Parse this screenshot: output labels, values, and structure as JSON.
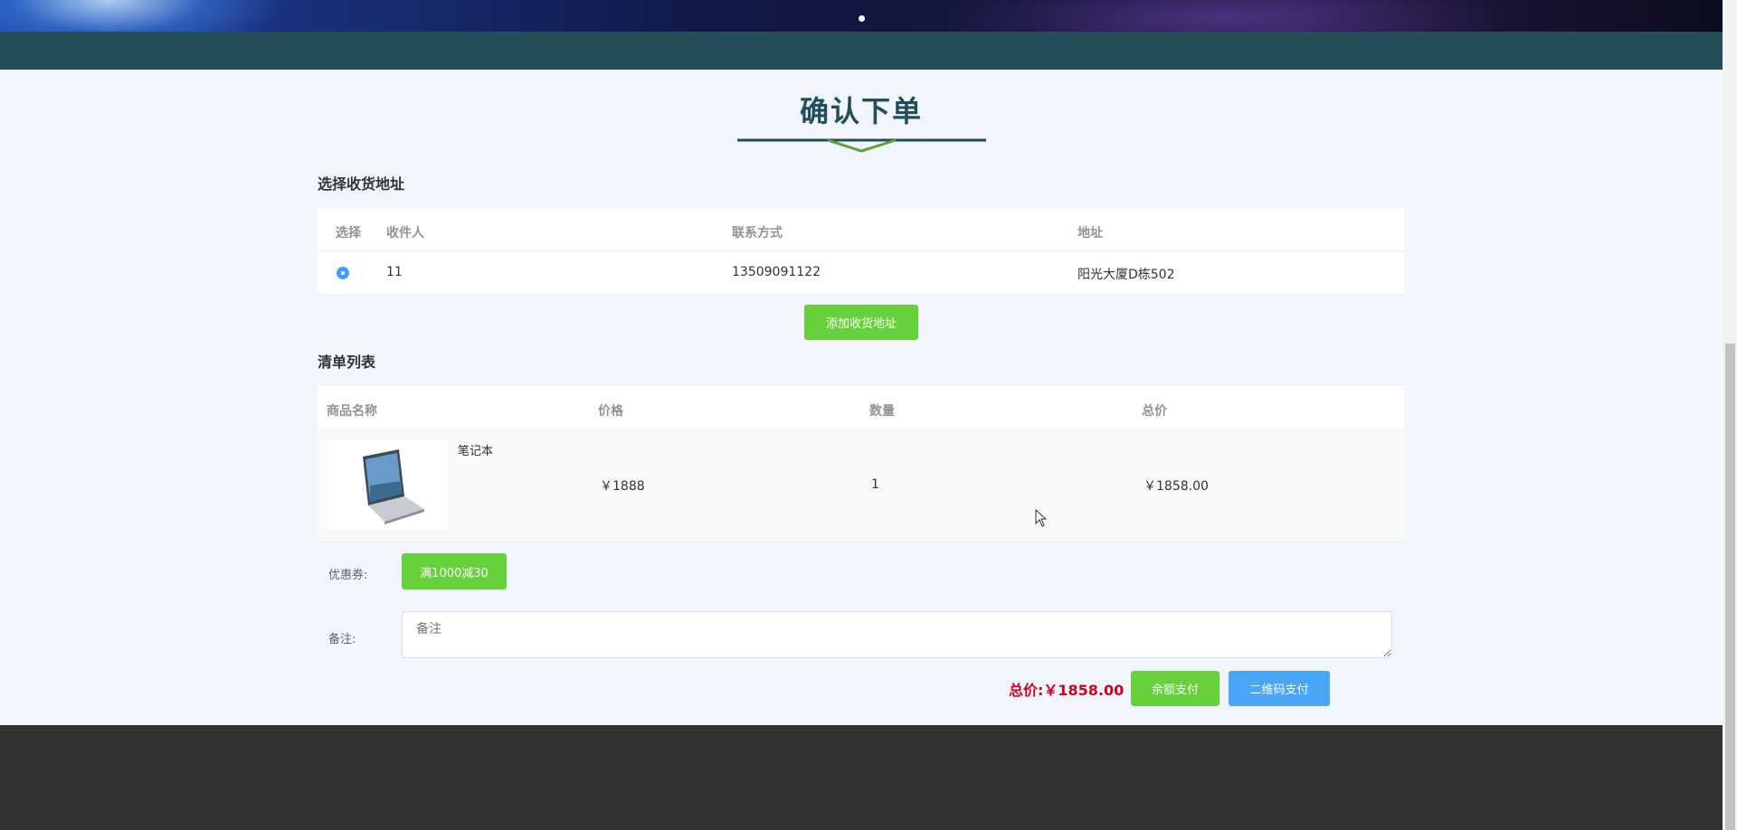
{
  "page": {
    "title": "确认下单",
    "address_section_title": "选择收货地址",
    "list_section_title": "清单列表"
  },
  "address_table": {
    "headers": [
      "选择",
      "收件人",
      "联系方式",
      "地址"
    ],
    "rows": [
      {
        "selected": true,
        "name": "11",
        "phone": "13509091122",
        "address": "阳光大厦D栋502"
      }
    ]
  },
  "add_address_button": "添加收货地址",
  "order_table": {
    "headers": [
      "商品名称",
      "价格",
      "数量",
      "总价"
    ],
    "rows": [
      {
        "name": "笔记本",
        "price": "￥1888",
        "quantity": "1",
        "subtotal": "￥1858.00",
        "image_icon": "laptop-image"
      }
    ]
  },
  "coupon": {
    "label": "优惠券:",
    "button": "满1000减30"
  },
  "remark": {
    "label": "备注:",
    "placeholder": "备注"
  },
  "summary": {
    "total_label": "总价:",
    "total_value": "￥1858.00"
  },
  "pay_buttons": {
    "balance": "余额支付",
    "qrcode": "二维码支付"
  },
  "colors": {
    "accent_green": "#67d13b",
    "accent_blue": "#4aa6f7",
    "price_red": "#d0021b",
    "header_teal": "#234e58"
  }
}
